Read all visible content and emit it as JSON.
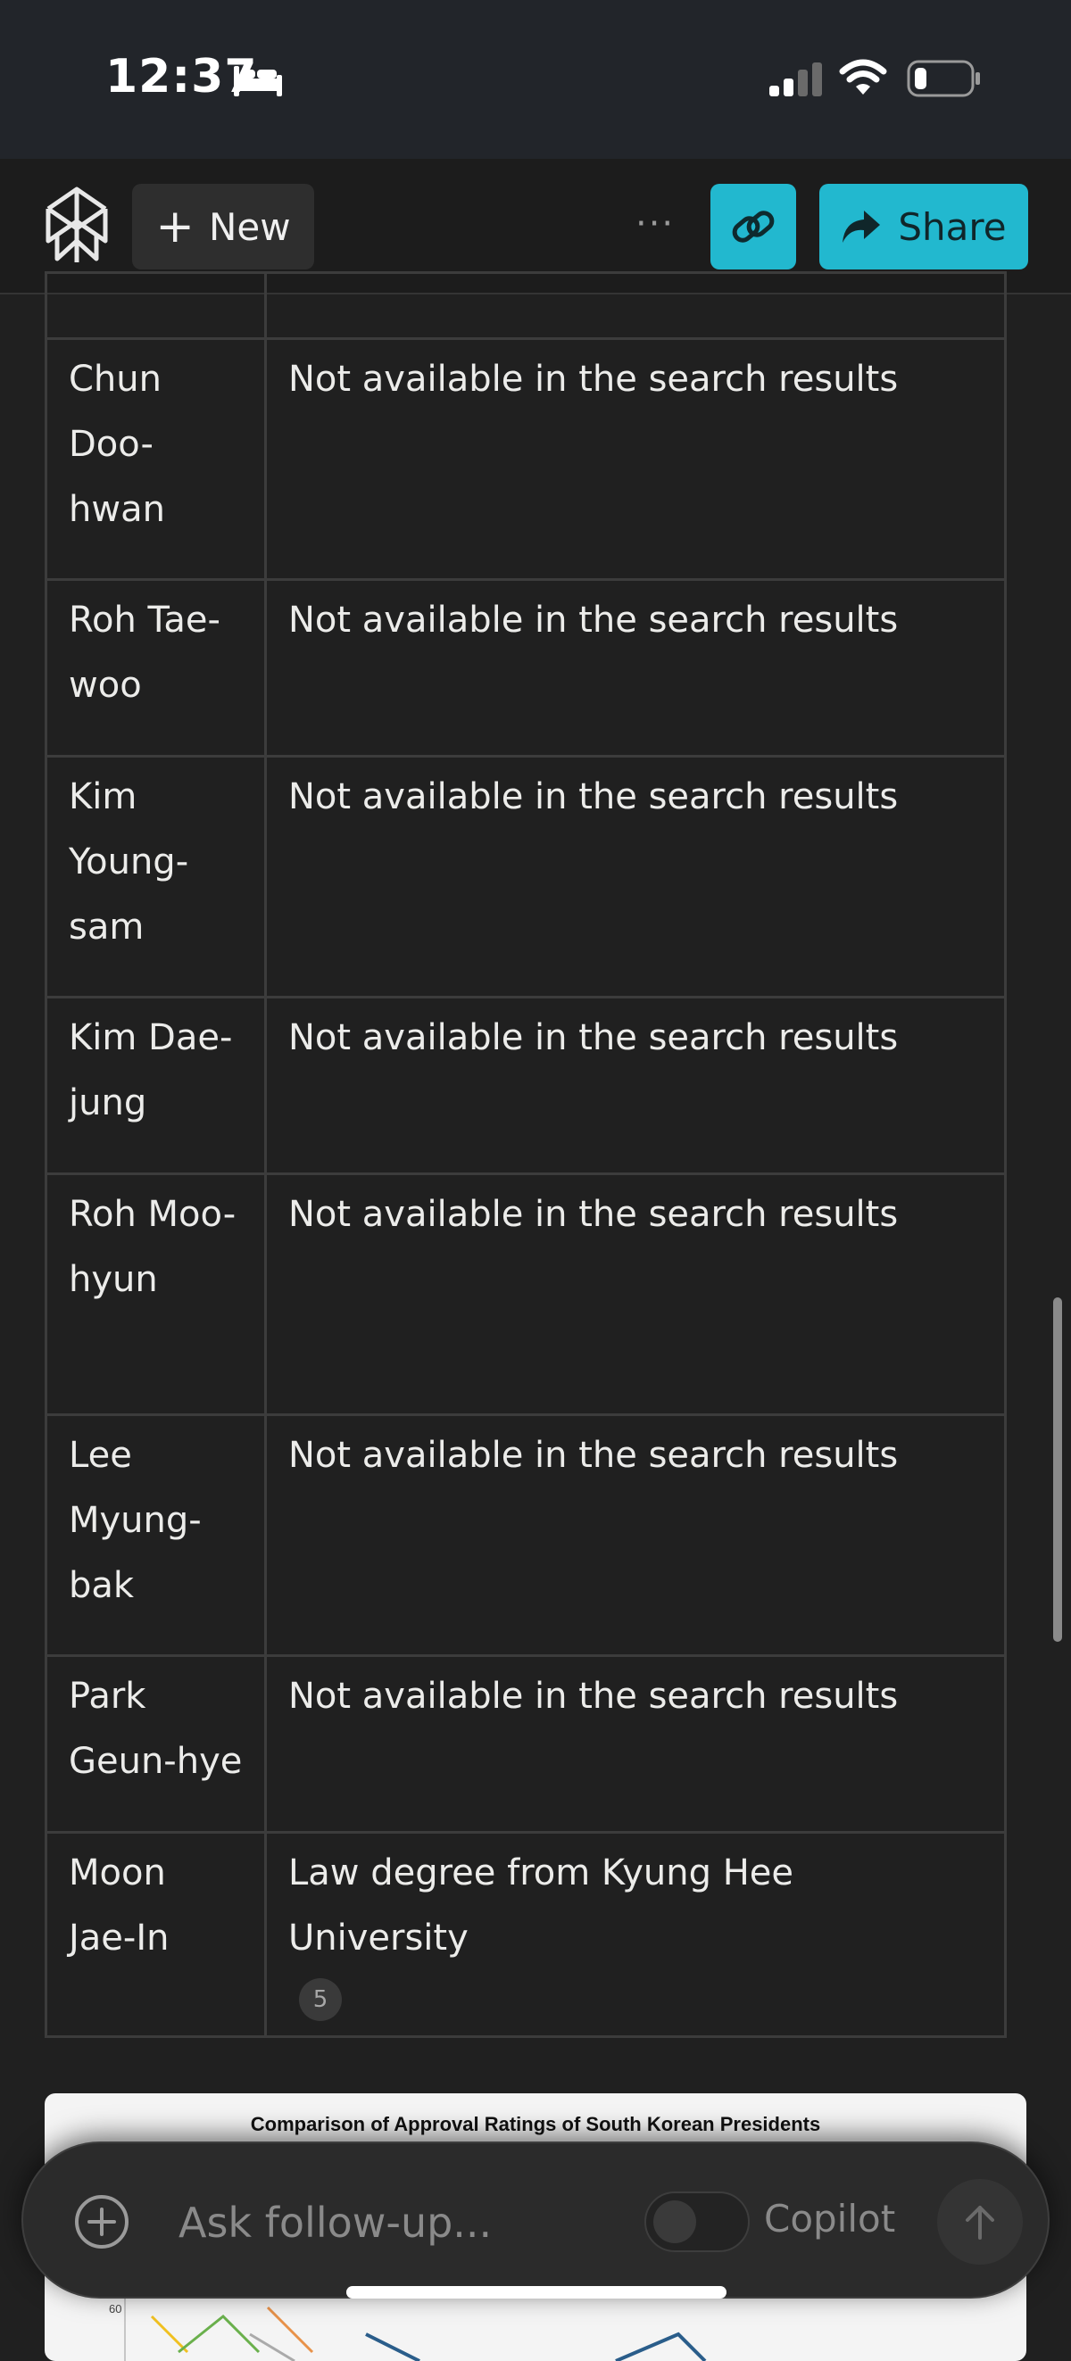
{
  "status_bar": {
    "time": "12:37"
  },
  "header": {
    "new_label": "New",
    "share_label": "Share"
  },
  "table": {
    "rows": [
      {
        "name": "Chun Doo-hwan",
        "detail": "Not available in the search results"
      },
      {
        "name": "Roh Tae-woo",
        "detail": "Not available in the search results"
      },
      {
        "name": "Kim Young-sam",
        "detail": "Not available in the search results"
      },
      {
        "name": "Kim Dae-jung",
        "detail": "Not available in the search results"
      },
      {
        "name": "Roh Moo-hyun",
        "detail": "Not available in the search results"
      },
      {
        "name": "Lee Myung-bak",
        "detail": "Not available in the search results"
      },
      {
        "name": "Park Geun-hye",
        "detail": "Not available in the search results"
      },
      {
        "name": "Moon Jae-In",
        "detail": "Law degree from Kyung Hee University",
        "citation": "5"
      }
    ]
  },
  "chart_card": {
    "title": "Comparison of Approval Ratings of South Korean Presidents",
    "tick_label": "60"
  },
  "composer": {
    "placeholder": "Ask follow-up...",
    "copilot_label": "Copilot"
  },
  "colors": {
    "accent": "#22b8cf",
    "background": "#202020",
    "header_bg": "#1c1c1c"
  },
  "icons": [
    "bed-icon",
    "signal-icon",
    "wifi-icon",
    "battery-icon",
    "perplexity-logo-icon",
    "plus-icon",
    "more-icon",
    "link-icon",
    "share-arrow-icon",
    "attach-icon",
    "send-arrow-icon"
  ]
}
